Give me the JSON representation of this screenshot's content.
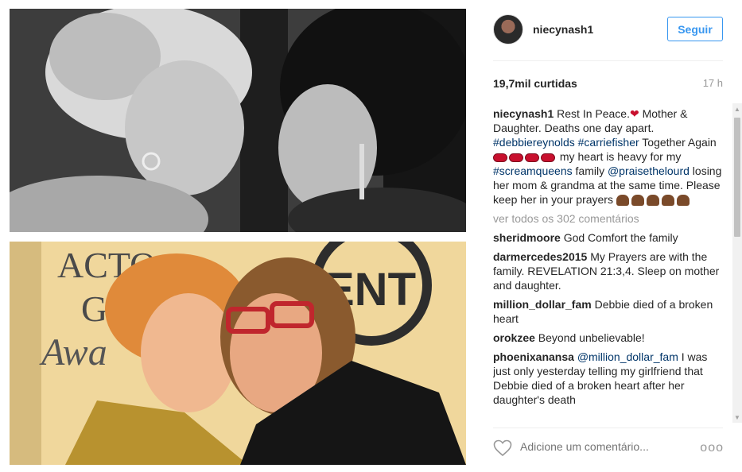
{
  "post": {
    "username": "niecynash1",
    "follow_label": "Seguir",
    "likes": "19,7mil curtidas",
    "time": "17 h",
    "caption": {
      "user": "niecynash1",
      "text_1": " Rest In Peace.",
      "text_2": " Mother & Daughter. Deaths one day apart. ",
      "tag_1": "#debbiereynolds",
      "space_1": " ",
      "tag_2": "#carriefisher",
      "text_3": " Together Again ",
      "text_4": " my heart is heavy for my ",
      "tag_3": "#screamqueens",
      "text_5": " family ",
      "tag_4": "@praisethelourd",
      "text_6": " losing her mom & grandma at the same time. Please keep her in your prayers "
    },
    "view_all": "ver todos os 302 comentários",
    "comments": [
      {
        "user": "sheridmoore",
        "text": " God Comfort the family"
      },
      {
        "user": "darmercedes2015",
        "text": " My Prayers are with the family. REVELATION 21:3,4. Sleep on mother and daughter."
      },
      {
        "user": "million_dollar_fam",
        "text": " Debbie died of a broken heart"
      },
      {
        "user": "orokzee",
        "text": " Beyond unbelievable!"
      },
      {
        "user": "phoenixanansa",
        "mention": "@million_dollar_fam",
        "text": " I was just only yesterday telling my girlfriend that Debbie died of a broken heart after her daughter's death"
      }
    ],
    "add_comment_placeholder": "Adicione um comentário...",
    "more_label": "ooo"
  },
  "photo": {
    "top_lettering": "",
    "bottom_lettering": [
      "ACTO",
      "GU",
      "Awa",
      "ENT"
    ]
  },
  "icons": {
    "heart": "heart-icon",
    "more": "more-options-icon",
    "avatar": "avatar"
  }
}
